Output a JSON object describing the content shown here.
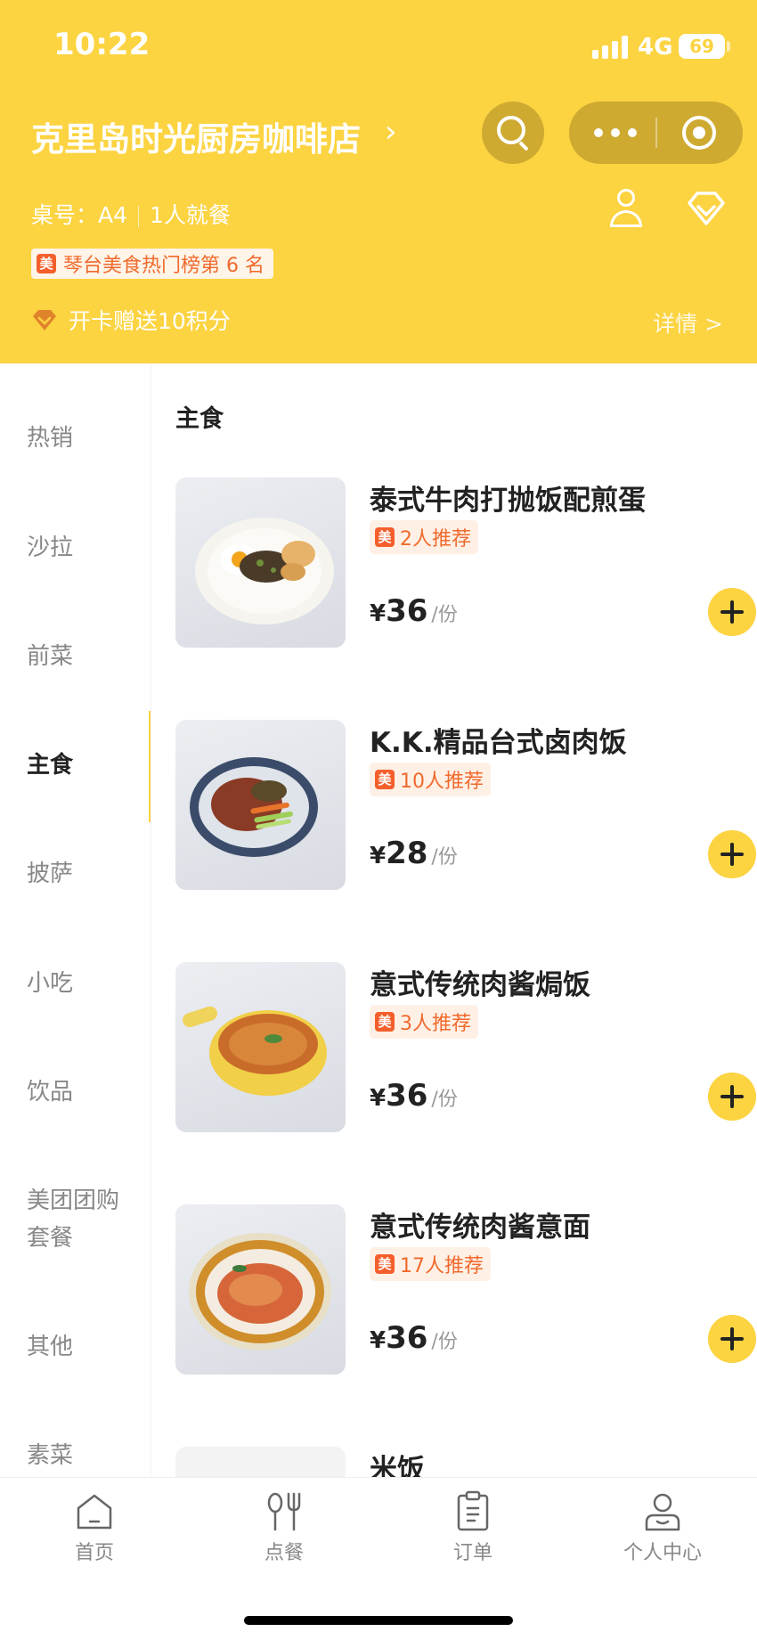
{
  "status_bar": {
    "time": "10:22",
    "network": "4G",
    "battery": "69"
  },
  "header": {
    "store_title": "克里岛时光厨房咖啡店",
    "table_label": "桌号：A4",
    "diners": "1人就餐",
    "rank_badge_logo": "美",
    "rank_badge": "琴台美食热门榜第 6 名",
    "points_promo": "开卡赠送10积分",
    "details_link": "详情 >"
  },
  "sidebar": {
    "items": [
      {
        "label": "热销"
      },
      {
        "label": "沙拉"
      },
      {
        "label": "前菜"
      },
      {
        "label": "主食"
      },
      {
        "label": "披萨"
      },
      {
        "label": "小吃"
      },
      {
        "label": "饮品"
      },
      {
        "label": "美团团购\n套餐"
      },
      {
        "label": "其他"
      },
      {
        "label": "素菜"
      }
    ],
    "active": "主食"
  },
  "menu": {
    "section_title": "主食",
    "badge_logo": "美",
    "currency": "¥",
    "unit": "/份",
    "dishes": [
      {
        "name": "泰式牛肉打抛饭配煎蛋",
        "recommend": "2人推荐",
        "price": "36"
      },
      {
        "name": "K.K.精品台式卤肉饭",
        "recommend": "10人推荐",
        "price": "28"
      },
      {
        "name": "意式传统肉酱焗饭",
        "recommend": "3人推荐",
        "price": "36"
      },
      {
        "name": "意式传统肉酱意面",
        "recommend": "17人推荐",
        "price": "36"
      },
      {
        "name": "米饭"
      }
    ]
  },
  "tabbar": {
    "tabs": [
      {
        "label": "首页",
        "icon": "home-icon"
      },
      {
        "label": "点餐",
        "icon": "utensils-icon"
      },
      {
        "label": "订单",
        "icon": "clipboard-icon"
      },
      {
        "label": "个人中心",
        "icon": "person-icon"
      }
    ]
  },
  "colors": {
    "brand_yellow": "#fcd341",
    "badge_orange": "#f45f2c",
    "badge_bg": "#fff0e6"
  }
}
